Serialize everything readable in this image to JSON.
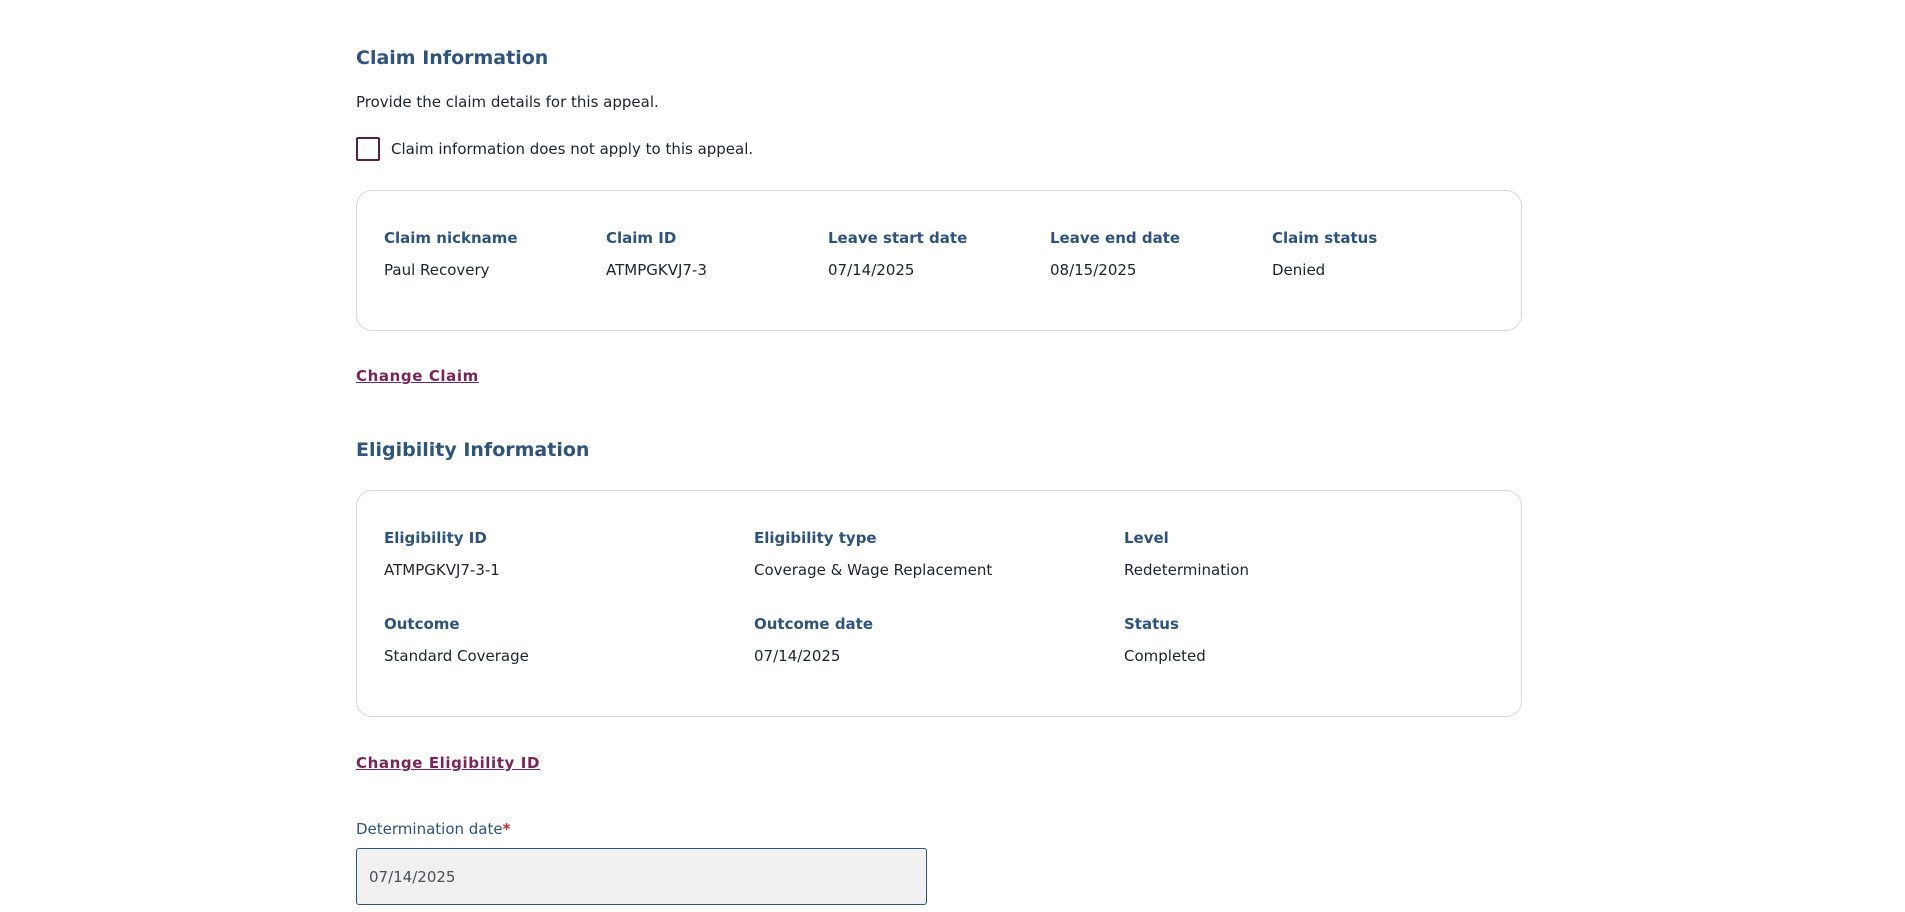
{
  "claim_section": {
    "title": "Claim Information",
    "intro": "Provide the claim details for this appeal.",
    "checkbox_label": "Claim information does not apply to this appeal.",
    "checkbox_checked": false,
    "fields": [
      {
        "label": "Claim nickname",
        "value": "Paul Recovery"
      },
      {
        "label": "Claim ID",
        "value": "ATMPGKVJ7-3"
      },
      {
        "label": "Leave start date",
        "value": "07/14/2025"
      },
      {
        "label": "Leave end date",
        "value": "08/15/2025"
      },
      {
        "label": "Claim status",
        "value": "Denied"
      }
    ],
    "change_link": "Change Claim"
  },
  "eligibility_section": {
    "title": "Eligibility Information",
    "fields": [
      {
        "label": "Eligibility ID",
        "value": "ATMPGKVJ7-3-1"
      },
      {
        "label": "Eligibility type",
        "value": "Coverage & Wage Replacement"
      },
      {
        "label": "Level",
        "value": "Redetermination"
      },
      {
        "label": "Outcome",
        "value": "Standard Coverage"
      },
      {
        "label": "Outcome date",
        "value": "07/14/2025"
      },
      {
        "label": "Status",
        "value": "Completed"
      }
    ],
    "change_link": "Change Eligibility ID"
  },
  "determination": {
    "label": "Determination date",
    "required_marker": "*",
    "value": "07/14/2025"
  },
  "colors": {
    "heading": "#2d5480",
    "link": "#7b2458",
    "checkbox_border": "#5a1f3f",
    "required": "#dd2222"
  }
}
